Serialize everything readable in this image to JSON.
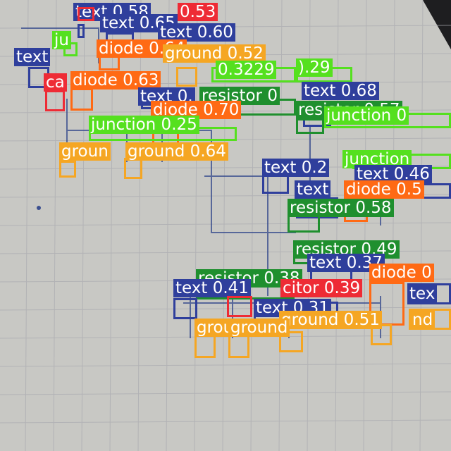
{
  "image": {
    "description_colors": {
      "text": "#2f3f9c",
      "diode": "#ff6a14",
      "ground": "#f5a623",
      "resistor": "#1f8f2e",
      "junction": "#55e01f",
      "capacitor": "#ee2b35"
    }
  },
  "detections": [
    {
      "cls": "text",
      "label": "text 0.58",
      "color": "#2f3f9c"
    },
    {
      "cls": "capacitor",
      "label": "0.53",
      "color": "#ee2b35"
    },
    {
      "cls": "text",
      "label": "text 0.65",
      "color": "#2f3f9c"
    },
    {
      "cls": "text",
      "label": "text 0.60",
      "color": "#2f3f9c"
    },
    {
      "cls": "junction",
      "label": "ju",
      "color": "#55e01f"
    },
    {
      "cls": "text",
      "label": "text",
      "color": "#2f3f9c"
    },
    {
      "cls": "diode",
      "label": "diode 0.64",
      "color": "#ff6a14"
    },
    {
      "cls": "ground",
      "label": "ground 0.52",
      "color": "#f5a623"
    },
    {
      "cls": "junction",
      "label": "0.3229",
      "color": "#55e01f"
    },
    {
      "cls": "junction",
      "label": ").29",
      "color": "#55e01f"
    },
    {
      "cls": "capacitor",
      "label": "ca",
      "color": "#ee2b35"
    },
    {
      "cls": "diode",
      "label": "diode 0.63",
      "color": "#ff6a14"
    },
    {
      "cls": "text",
      "label": "text 0.",
      "color": "#2f3f9c"
    },
    {
      "cls": "resistor",
      "label": "resistor 0",
      "color": "#1f8f2e"
    },
    {
      "cls": "text",
      "label": "text 0.68",
      "color": "#2f3f9c"
    },
    {
      "cls": "resistor",
      "label": "resistor 0.57",
      "color": "#1f8f2e"
    },
    {
      "cls": "junction",
      "label": "junction 0",
      "color": "#55e01f"
    },
    {
      "cls": "diode",
      "label": "diode 0.70",
      "color": "#ff6a14"
    },
    {
      "cls": "junction",
      "label": "junction 0.25",
      "color": "#55e01f"
    },
    {
      "cls": "ground",
      "label": "groun",
      "color": "#f5a623"
    },
    {
      "cls": "ground",
      "label": "ground 0.64",
      "color": "#f5a623"
    },
    {
      "cls": "junction",
      "label": "junction",
      "color": "#55e01f"
    },
    {
      "cls": "text",
      "label": "text 0.2",
      "color": "#2f3f9c"
    },
    {
      "cls": "text",
      "label": "text 0.46",
      "color": "#2f3f9c"
    },
    {
      "cls": "text",
      "label": "text",
      "color": "#2f3f9c"
    },
    {
      "cls": "diode",
      "label": "diode 0.5",
      "color": "#ff6a14"
    },
    {
      "cls": "resistor",
      "label": "resistor 0.58",
      "color": "#1f8f2e"
    },
    {
      "cls": "resistor",
      "label": "resistor 0.49",
      "color": "#1f8f2e"
    },
    {
      "cls": "text",
      "label": "text 0.37",
      "color": "#2f3f9c"
    },
    {
      "cls": "resistor",
      "label": "resistor 0.38",
      "color": "#1f8f2e"
    },
    {
      "cls": "diode",
      "label": "diode 0",
      "color": "#ff6a14"
    },
    {
      "cls": "text",
      "label": "text 0.41",
      "color": "#2f3f9c"
    },
    {
      "cls": "capacitor",
      "label": "citor 0.39",
      "color": "#ee2b35"
    },
    {
      "cls": "text",
      "label": "tex",
      "color": "#2f3f9c"
    },
    {
      "cls": "text",
      "label": "text 0.31",
      "color": "#2f3f9c"
    },
    {
      "cls": "ground",
      "label": "ground 0.48",
      "color": "#f5a623"
    },
    {
      "cls": "ground",
      "label": "ground 0.51",
      "color": "#f5a623"
    },
    {
      "cls": "ground",
      "label": "nd",
      "color": "#f5a623"
    },
    {
      "cls": "ground",
      "label": "ground",
      "color": "#f5a623"
    },
    {
      "cls": "ground",
      "label": "ground",
      "color": "#f5a623"
    }
  ]
}
